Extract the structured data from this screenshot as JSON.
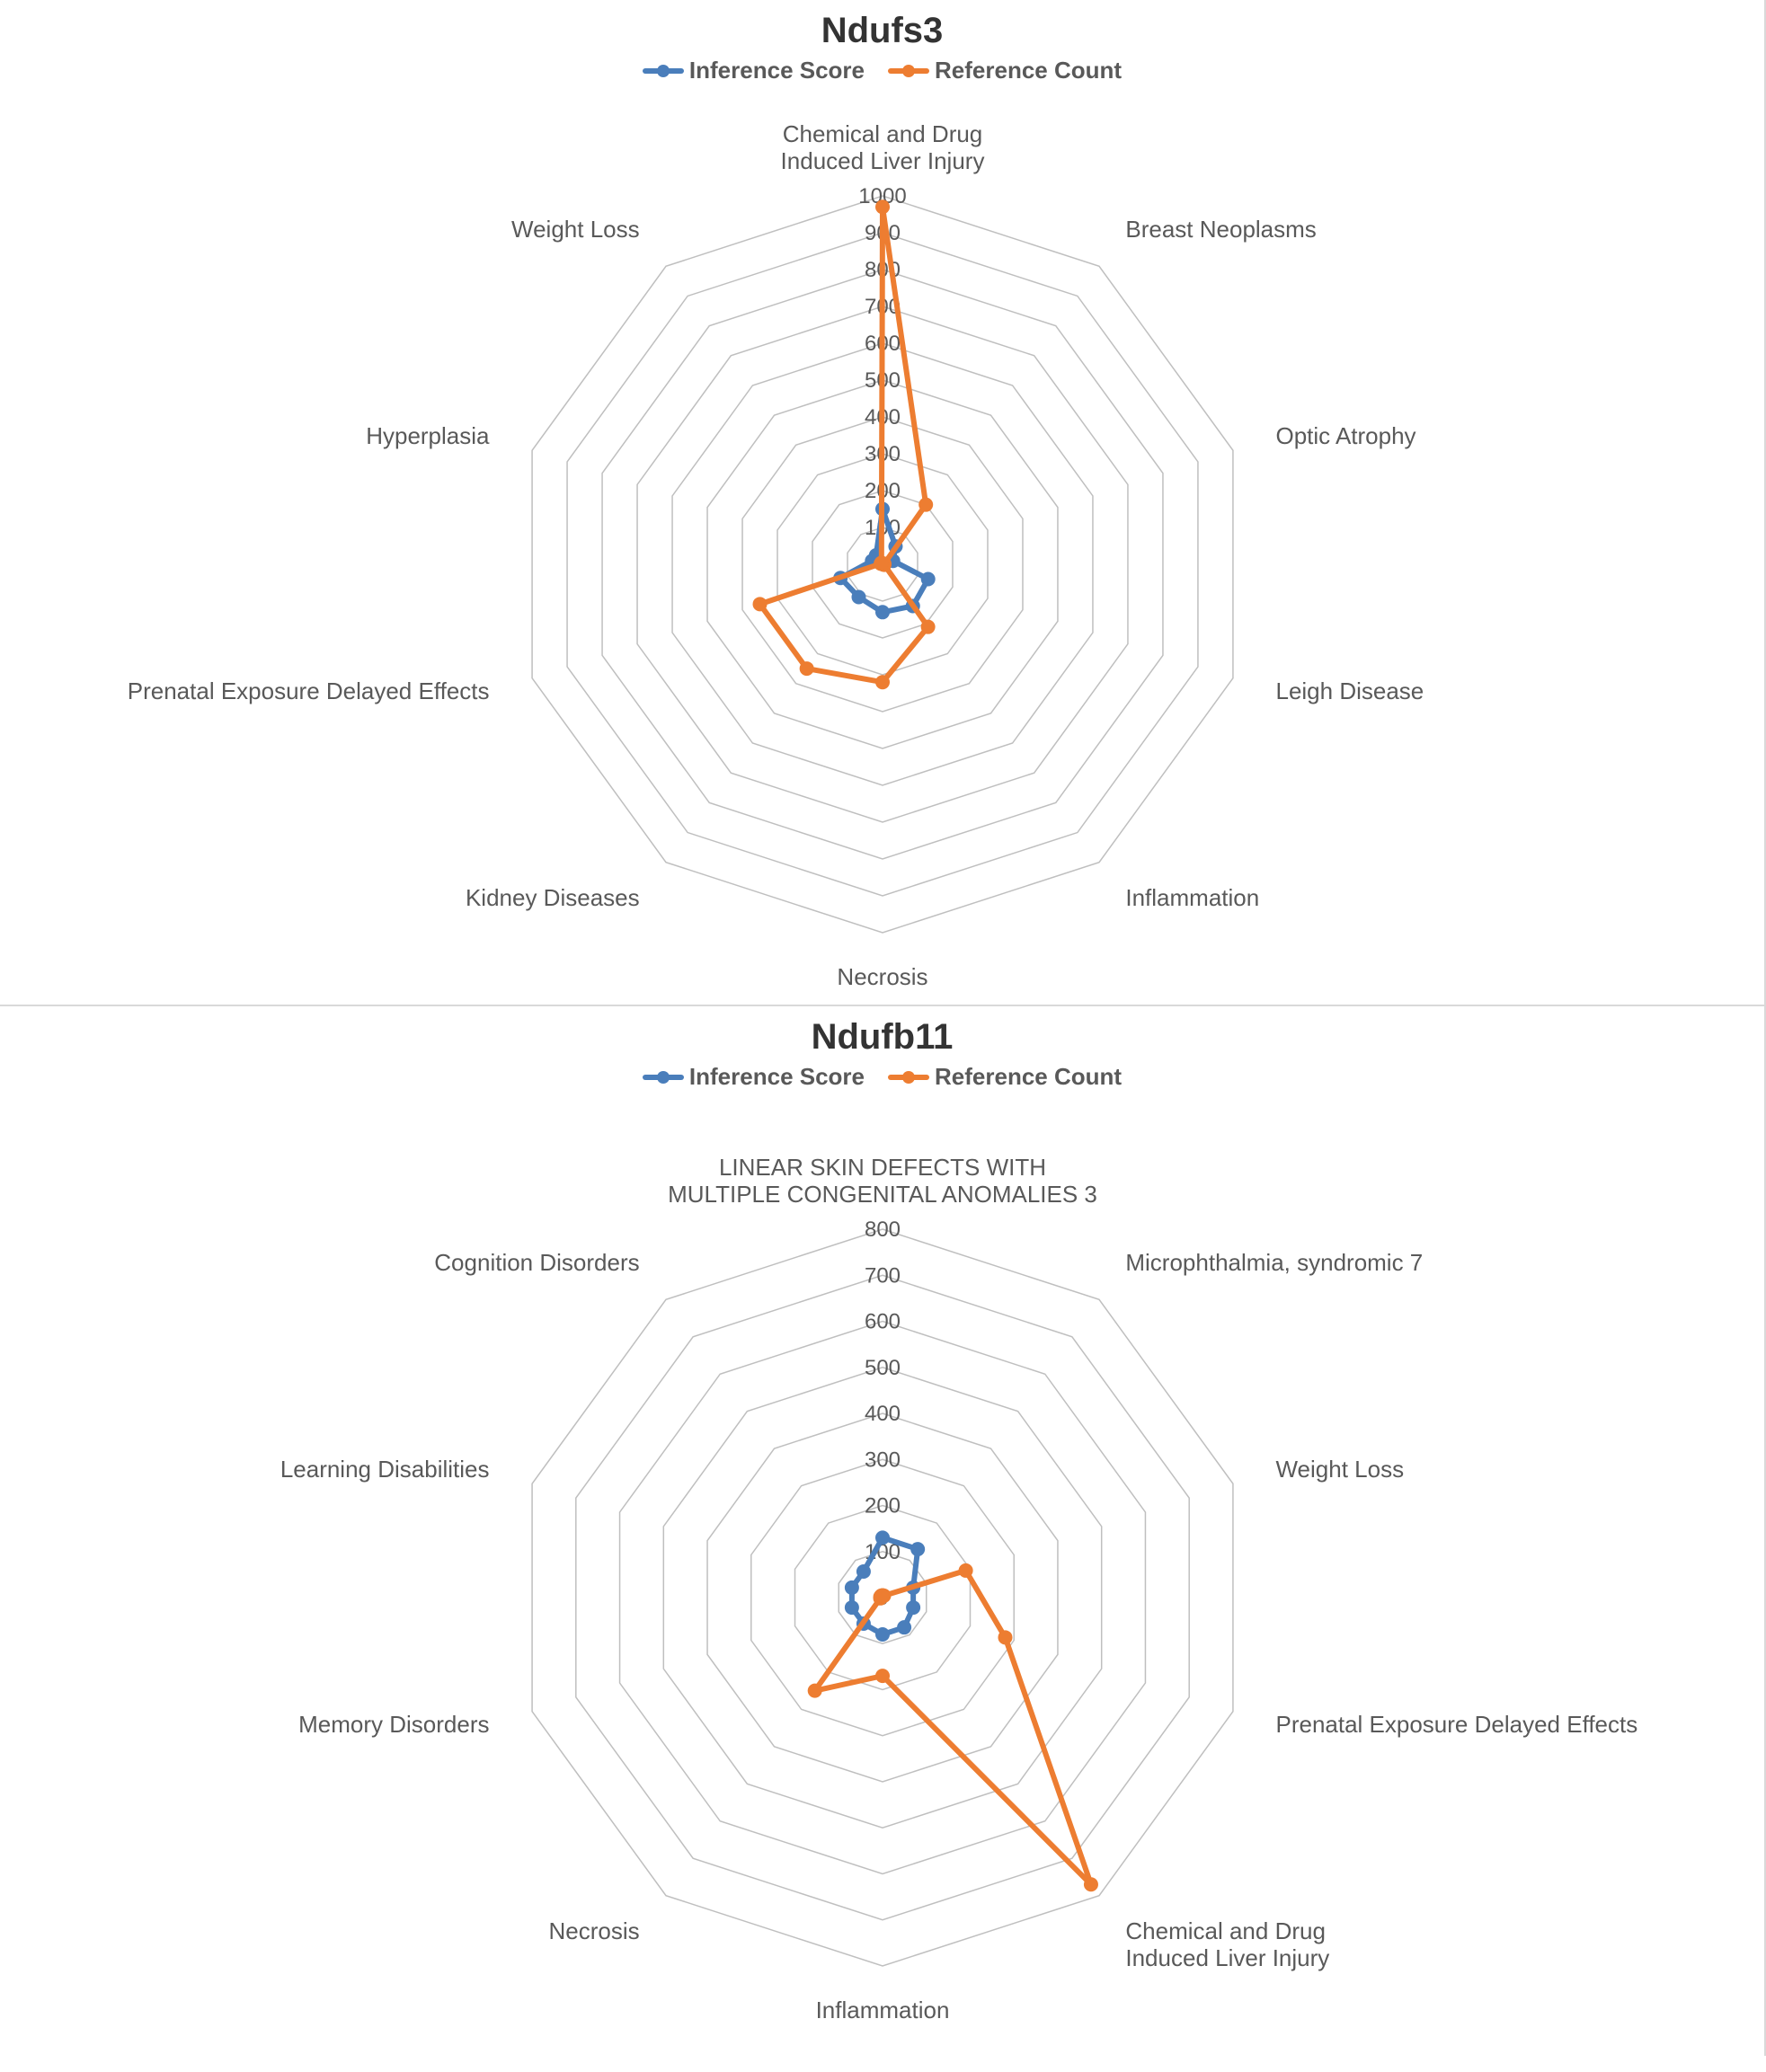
{
  "chart_data": [
    {
      "id": "ndufs3",
      "title": "Ndufs3",
      "type": "radar",
      "legend": {
        "series1": "Inference Score",
        "series2": "Reference Count"
      },
      "categories": [
        "Chemical and Drug Induced Liver Injury",
        "Breast Neoplasms",
        "Optic Atrophy",
        "Leigh Disease",
        "Inflammation",
        "Necrosis",
        "Kidney Diseases",
        "Prenatal Exposure Delayed Effects",
        "Hyperplasia",
        "Weight Loss"
      ],
      "ticks": [
        0,
        100,
        200,
        300,
        400,
        500,
        600,
        700,
        800,
        900,
        1000
      ],
      "ylim": [
        0,
        1000
      ],
      "series": [
        {
          "name": "Inference Score",
          "color": "#4a7ebb",
          "values": [
            150,
            60,
            30,
            130,
            140,
            130,
            110,
            120,
            30,
            30
          ]
        },
        {
          "name": "Reference Count",
          "color": "#ed7d31",
          "values": [
            970,
            200,
            5,
            5,
            210,
            320,
            350,
            350,
            5,
            5
          ]
        }
      ]
    },
    {
      "id": "ndufb11",
      "title": "Ndufb11",
      "type": "radar",
      "legend": {
        "series1": "Inference Score",
        "series2": "Reference Count"
      },
      "categories": [
        "LINEAR SKIN DEFECTS WITH MULTIPLE CONGENITAL ANOMALIES 3",
        "Microphthalmia, syndromic 7",
        "Weight Loss",
        "Prenatal Exposure Delayed Effects",
        "Chemical and Drug Induced Liver Injury",
        "Inflammation",
        "Necrosis",
        "Memory Disorders",
        "Learning Disabilities",
        "Cognition Disorders"
      ],
      "ticks": [
        0,
        100,
        200,
        300,
        400,
        500,
        600,
        700,
        800
      ],
      "ylim": [
        0,
        800
      ],
      "series": [
        {
          "name": "Inference Score",
          "color": "#4a7ebb",
          "values": [
            130,
            130,
            70,
            70,
            80,
            80,
            70,
            70,
            70,
            70
          ]
        },
        {
          "name": "Reference Count",
          "color": "#ed7d31",
          "values": [
            5,
            5,
            190,
            280,
            770,
            170,
            250,
            5,
            5,
            5
          ]
        }
      ]
    }
  ]
}
